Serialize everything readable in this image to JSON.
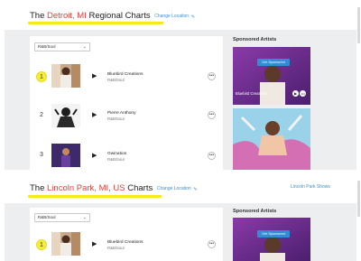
{
  "panel1": {
    "title_prefix": "The",
    "title_location": "Detroit, MI",
    "title_suffix": "Regional Charts",
    "change_location": "Change Location",
    "pencil_icon": "pencil-icon",
    "genre_select": "R&B/Soul",
    "rows": [
      {
        "rank": "1",
        "name": "Bluebird Creations",
        "genre": "R&B/Soul"
      },
      {
        "rank": "2",
        "name": "Pierre Anthony",
        "genre": "R&B/Soul"
      },
      {
        "rank": "3",
        "name": "Gwination",
        "genre": "R&B/Soul"
      }
    ],
    "sponsored_title": "Sponsored Artists",
    "get_sponsored": "Get Sponsored",
    "sponsored_name": "Bluebird Creations"
  },
  "panel2": {
    "title_prefix": "The",
    "title_location": "Lincoln Park, MI, US",
    "title_suffix": "Charts",
    "change_location": "Change Location",
    "pencil_icon": "pencil-icon",
    "shows_link": "Lincoln Park Shows",
    "genre_select": "R&B/Soul",
    "rows": [
      {
        "rank": "1",
        "name": "Bluebird Creations",
        "genre": "R&B/Soul"
      }
    ],
    "sponsored_title": "Sponsored Artists",
    "get_sponsored": "Get Sponsored"
  },
  "icons": {
    "play": "play-icon",
    "more": "more-options-icon",
    "dropdown": "chevron-down-icon"
  }
}
